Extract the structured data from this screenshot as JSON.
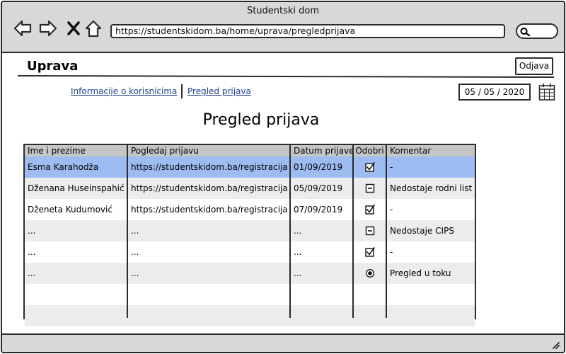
{
  "window": {
    "title": "Studentski dom"
  },
  "browser": {
    "url": "https://studentskidom.ba/home/uprava/pregledprijava"
  },
  "header": {
    "app_title": "Uprava",
    "logout_label": "Odjava"
  },
  "nav": {
    "links": [
      "Informacije o korisnicima",
      "Pregled prijava"
    ]
  },
  "date": {
    "value": "05 / 05 / 2020"
  },
  "page": {
    "title": "Pregled prijava"
  },
  "table": {
    "columns": [
      "Ime i prezime",
      "Pogledaj prijavu",
      "Datum prijave",
      "Odobri",
      "Komentar"
    ],
    "rows": [
      {
        "name": "Esma Karahodža",
        "link": "https://studentskidom.ba/registracija",
        "date": "01/09/2019",
        "status": "approved",
        "comment": "-",
        "selected": true
      },
      {
        "name": "Dženana Huseinspahić",
        "link": "https://studentskidom.ba/registracija",
        "date": "05/09/2019",
        "status": "rejected",
        "comment": "Nedostaje rodni list",
        "selected": false
      },
      {
        "name": "Dženeta Kudumović",
        "link": "https://studentskidom.ba/registracija",
        "date": "07/09/2019",
        "status": "approved",
        "comment": "-",
        "selected": false
      },
      {
        "name": "...",
        "link": "...",
        "date": "...",
        "status": "rejected",
        "comment": "Nedostaje CIPS",
        "selected": false
      },
      {
        "name": "...",
        "link": "...",
        "date": "...",
        "status": "approved",
        "comment": "-",
        "selected": false
      },
      {
        "name": "...",
        "link": "...",
        "date": "...",
        "status": "pending",
        "comment": "Pregled u toku",
        "selected": false
      },
      {
        "name": "",
        "link": "",
        "date": "",
        "status": "",
        "comment": "",
        "selected": false
      },
      {
        "name": "",
        "link": "",
        "date": "",
        "status": "",
        "comment": "",
        "selected": false
      }
    ]
  },
  "colors": {
    "selected_row": "#9dbdf2",
    "alt_row": "#ececec",
    "chrome": "#d8d8d8",
    "link": "#1f3f8f"
  },
  "icons": {
    "back": "back-arrow-icon",
    "forward": "forward-arrow-icon",
    "close": "close-icon",
    "home": "home-icon",
    "search": "search-icon",
    "calendar": "calendar-icon",
    "approved": "checkbox-checked-icon",
    "rejected": "minus-box-icon",
    "pending": "radio-selected-icon",
    "resize": "resize-grip-icon"
  }
}
